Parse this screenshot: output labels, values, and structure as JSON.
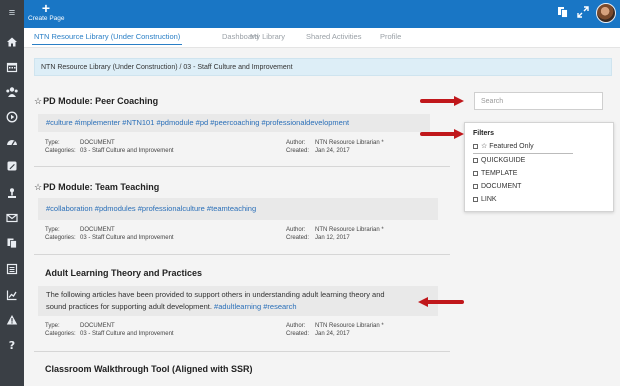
{
  "topbar": {
    "create_label": "Create Page",
    "plus_glyph": "+",
    "icons": [
      "pages-icon",
      "expand-icon"
    ]
  },
  "rail": {
    "menu_glyph": "≡",
    "items": [
      "home-icon",
      "calendar-icon",
      "users-icon",
      "play-icon",
      "dashboard-icon",
      "edit-icon",
      "upload-icon",
      "mail-icon",
      "copy-icon",
      "list-icon",
      "chart-icon",
      "warning-icon",
      "help-icon"
    ]
  },
  "tabs": [
    {
      "label": "NTN Resource Library (Under Construction)",
      "active": true
    },
    {
      "label": "Dashboard",
      "active": false
    },
    {
      "label": "My Library",
      "active": false
    },
    {
      "label": "Shared Activities",
      "active": false
    },
    {
      "label": "Profile",
      "active": false
    }
  ],
  "breadcrumb": "NTN Resource Library (Under Construction) / 03 - Staff Culture and Improvement",
  "cards": [
    {
      "star": "☆",
      "title": "PD Module: Peer Coaching",
      "tags": "#culture #implementer #NTN101 #pdmodule #pd #peercoaching #professionaldevelopment",
      "type_label": "Type:",
      "type_value": "DOCUMENT",
      "categories_label": "Categories:",
      "categories_value": "03 - Staff Culture and Improvement",
      "author_label": "Author:",
      "author_value": "NTN Resource Librarian *",
      "created_label": "Created:",
      "created_value": "Jan 24, 2017"
    },
    {
      "star": "☆",
      "title": "PD Module: Team Teaching",
      "tags": "#collaboration #pdmodules #professionalculture #teamteaching",
      "type_label": "Type:",
      "type_value": "DOCUMENT",
      "categories_label": "Categories:",
      "categories_value": "03 - Staff Culture and Improvement",
      "author_label": "Author:",
      "author_value": "NTN Resource Librarian *",
      "created_label": "Created:",
      "created_value": "Jan 12, 2017"
    },
    {
      "star": "",
      "title": "Adult Learning Theory and Practices",
      "description_line1": "The following articles have been provided to support others in understanding adult learning theory and",
      "description_line2": "sound practices for supporting adult development.",
      "description_tags": "#adultlearning #research",
      "type_label": "Type:",
      "type_value": "DOCUMENT",
      "categories_label": "Categories:",
      "categories_value": "03 - Staff Culture and Improvement",
      "author_label": "Author:",
      "author_value": "NTN Resource Librarian *",
      "created_label": "Created:",
      "created_value": "Jan 24, 2017"
    },
    {
      "star": "",
      "title": "Classroom Walkthrough Tool (Aligned with SSR)"
    }
  ],
  "search": {
    "placeholder": "Search"
  },
  "filters": {
    "heading": "Filters",
    "featured_label": "☆ Featured Only",
    "options": [
      "QUICKGUIDE",
      "TEMPLATE",
      "DOCUMENT",
      "LINK"
    ]
  },
  "colors": {
    "topbar": "#1976c5",
    "rail": "#3a3f45",
    "tag": "#2a6fb8",
    "annotation_arrow": "#c0171b"
  }
}
